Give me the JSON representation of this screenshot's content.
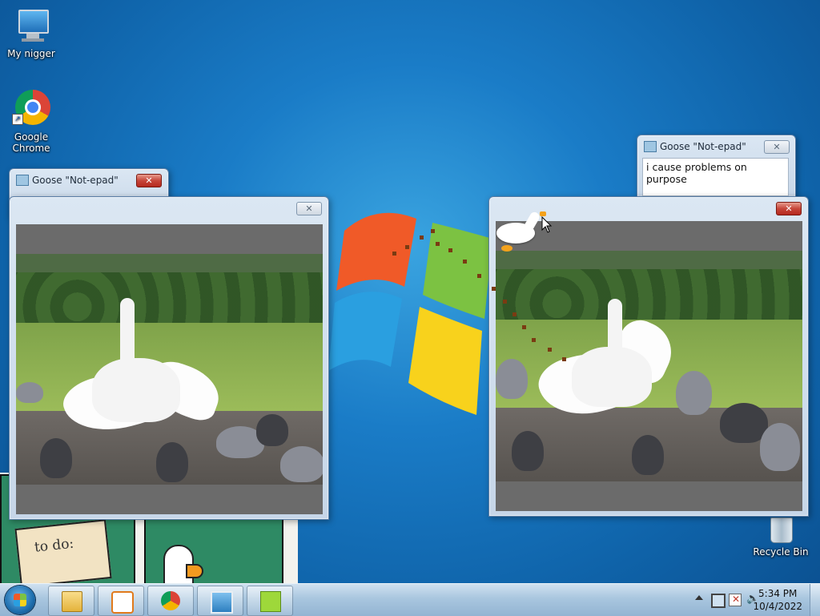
{
  "desktop": {
    "icons": [
      {
        "label": "My nigger",
        "icon": "computer-icon"
      },
      {
        "label": "Google\nChrome",
        "icon": "chrome-icon"
      },
      {
        "label": "Recycle Bin",
        "icon": "recycle-bin-icon"
      }
    ]
  },
  "windows": {
    "notepad_left": {
      "title": "Goose \"Not-epad\"",
      "close": "✕"
    },
    "notepad_right": {
      "title": "Goose \"Not-epad\"",
      "close": "✕",
      "text": "i cause problems on purpose"
    },
    "image_left": {
      "close": "✕"
    },
    "image_right": {
      "close": "✕"
    }
  },
  "comic": {
    "note_text": "to do:"
  },
  "taskbar": {
    "buttons": [
      "file-explorer-icon",
      "media-player-icon",
      "chrome-icon",
      "photo-viewer-icon",
      "goose-app-icon"
    ],
    "tray_icons": [
      "show-hidden-icons-arrow",
      "network-icon",
      "action-center-icon",
      "volume-icon"
    ],
    "time": "5:34 PM",
    "date": "10/4/2022"
  },
  "colors": {
    "accent": "#1a7cc7",
    "close_red": "#c6463a"
  }
}
